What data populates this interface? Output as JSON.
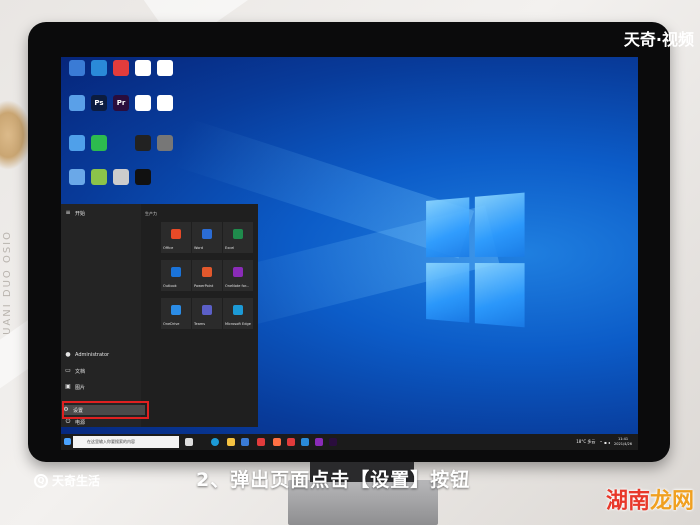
{
  "watermark_top": "天奇·视频",
  "background": {
    "side_text": "UANI DUO OSIO"
  },
  "desktop": {
    "icons": [
      {
        "label": "",
        "color": "#3a7bd5"
      },
      {
        "label": "",
        "color": "#2a8ad8"
      },
      {
        "label": "",
        "color": "#e23c3c"
      },
      {
        "label": "",
        "color": "#ffffff"
      },
      {
        "label": "",
        "color": "#ffffff"
      },
      {
        "label": "",
        "color": "#5aa0e8"
      },
      {
        "label": "Ps",
        "color": "#0c1c3f"
      },
      {
        "label": "Pr",
        "color": "#2a0d3d"
      },
      {
        "label": "",
        "color": "#ffffff"
      },
      {
        "label": "",
        "color": "#ffffff"
      },
      {
        "label": "",
        "color": "#4fa0ea"
      },
      {
        "label": "",
        "color": "#2dbb4f"
      },
      {
        "label": "",
        "color": "#222222"
      },
      {
        "label": "",
        "color": "#777777"
      },
      {
        "label": "",
        "color": "#6aa8e8"
      },
      {
        "label": "",
        "color": "#8bc34a"
      },
      {
        "label": "",
        "color": "#cccccc"
      },
      {
        "label": "",
        "color": "#111111"
      }
    ]
  },
  "start_menu": {
    "header": "开始",
    "tiles_header": "生产力",
    "rail": [
      {
        "icon": "user-icon",
        "label": "Administrator"
      },
      {
        "icon": "document-icon",
        "label": "文档"
      },
      {
        "icon": "picture-icon",
        "label": "图片"
      },
      {
        "icon": "gear-icon",
        "label": "设置"
      },
      {
        "icon": "power-icon",
        "label": "电源"
      }
    ],
    "tiles": [
      {
        "label": "Office",
        "color": "#e74a27"
      },
      {
        "label": "Word",
        "color": "#2b6cd4"
      },
      {
        "label": "Excel",
        "color": "#1f8b4c"
      },
      {
        "label": "Outlook",
        "color": "#1a73d9"
      },
      {
        "label": "PowerPoint",
        "color": "#e2582c"
      },
      {
        "label": "OneNote for...",
        "color": "#8a2bb8"
      },
      {
        "label": "OneDrive",
        "color": "#2b8ce6"
      },
      {
        "label": "Teams",
        "color": "#5b5fc7"
      },
      {
        "label": "Microsoft Edge",
        "color": "#1c9ad6"
      }
    ]
  },
  "taskbar": {
    "search_placeholder": "在这里输入你要搜索的内容",
    "tray_weather": "18°C 多云",
    "time": "11:41",
    "date": "2021/4/26"
  },
  "caption": "2、弹出页面点击【设置】按钮",
  "brand": "天奇生活",
  "corner_mark": {
    "part1": "湖南",
    "part2": "龙网"
  }
}
